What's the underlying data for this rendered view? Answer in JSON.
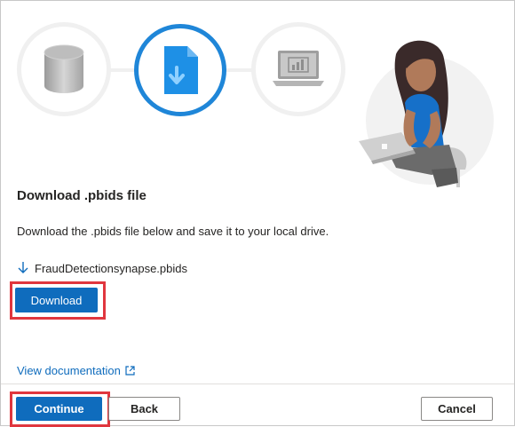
{
  "colors": {
    "primary": "#0f6cbd",
    "active_step": "#1f86d8",
    "highlight": "#e0363e"
  },
  "stepper": {
    "steps": [
      {
        "icon": "database-icon",
        "state": "complete"
      },
      {
        "icon": "download-file-icon",
        "state": "active"
      },
      {
        "icon": "report-laptop-icon",
        "state": "upcoming"
      }
    ]
  },
  "content": {
    "title": "Download .pbids file",
    "description": "Download the .pbids file below and save it to your local drive.",
    "file_name": "FraudDetectionsynapse.pbids",
    "download_label": "Download",
    "doc_link": "View documentation"
  },
  "footer": {
    "continue_label": "Continue",
    "back_label": "Back",
    "cancel_label": "Cancel"
  }
}
